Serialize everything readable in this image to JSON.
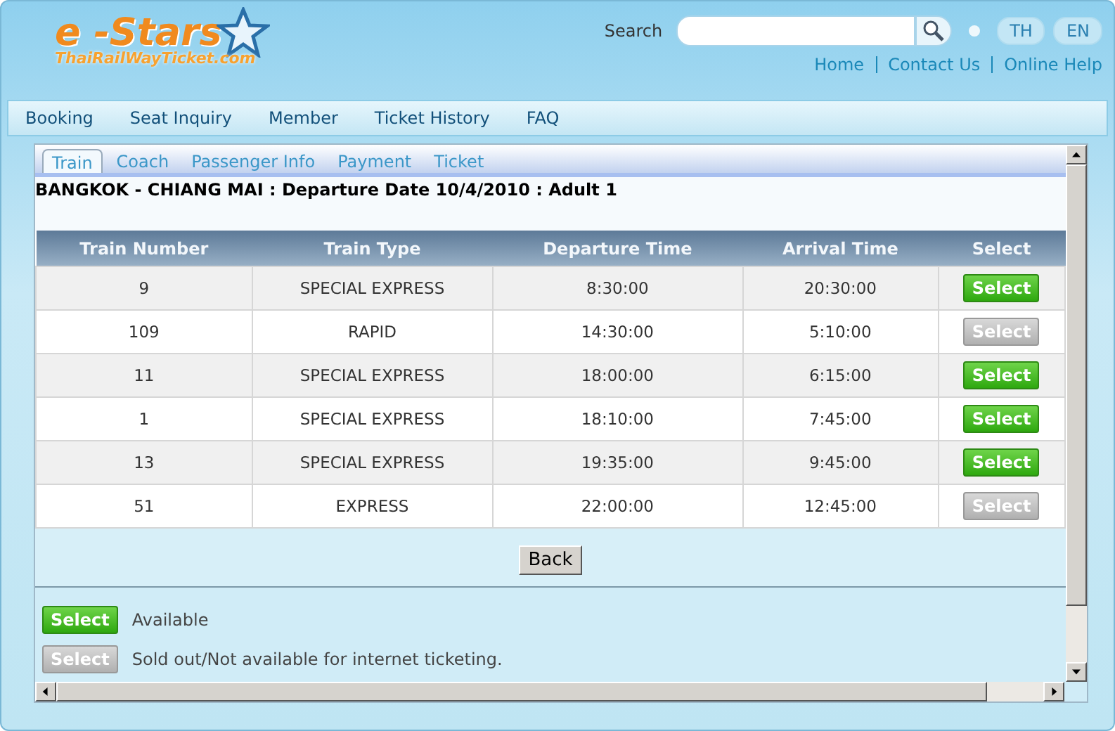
{
  "logo": {
    "title": "e -Stars",
    "subtitle": "ThaiRailWayTicket.com"
  },
  "search": {
    "label": "Search"
  },
  "languages": [
    {
      "label": "TH",
      "selected": false
    },
    {
      "label": "EN",
      "selected": false
    }
  ],
  "top_links": [
    "Home",
    "Contact Us",
    "Online Help"
  ],
  "nav": [
    "Booking",
    "Seat Inquiry",
    "Member",
    "Ticket History",
    "FAQ"
  ],
  "tabs": [
    {
      "label": "Train",
      "selected": true
    },
    {
      "label": "Coach",
      "selected": false
    },
    {
      "label": "Passenger Info",
      "selected": false
    },
    {
      "label": "Payment",
      "selected": false
    },
    {
      "label": "Ticket",
      "selected": false
    }
  ],
  "journey": "BANGKOK - CHIANG MAI : Departure Date 10/4/2010 : Adult 1",
  "table": {
    "columns": [
      "Train Number",
      "Train Type",
      "Departure Time",
      "Arrival Time",
      "Select"
    ],
    "rows": [
      {
        "number": "9",
        "type": "SPECIAL EXPRESS",
        "departure": "8:30:00",
        "arrival": "20:30:00",
        "button": "Select",
        "available": true
      },
      {
        "number": "109",
        "type": "RAPID",
        "departure": "14:30:00",
        "arrival": "5:10:00",
        "button": "Select",
        "available": false
      },
      {
        "number": "11",
        "type": "SPECIAL EXPRESS",
        "departure": "18:00:00",
        "arrival": "6:15:00",
        "button": "Select",
        "available": true
      },
      {
        "number": "1",
        "type": "SPECIAL EXPRESS",
        "departure": "18:10:00",
        "arrival": "7:45:00",
        "button": "Select",
        "available": true
      },
      {
        "number": "13",
        "type": "SPECIAL EXPRESS",
        "departure": "19:35:00",
        "arrival": "9:45:00",
        "button": "Select",
        "available": true
      },
      {
        "number": "51",
        "type": "EXPRESS",
        "departure": "22:00:00",
        "arrival": "12:45:00",
        "button": "Select",
        "available": false
      }
    ]
  },
  "back_button": "Back",
  "legend": [
    {
      "button": "Select",
      "available": true,
      "text": "Available"
    },
    {
      "button": "Select",
      "available": false,
      "text": "Sold out/Not available for internet ticketing."
    }
  ]
}
